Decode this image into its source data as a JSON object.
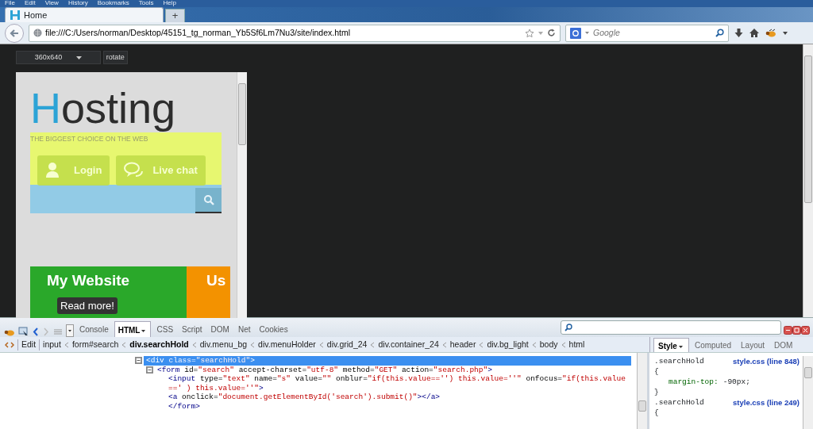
{
  "menu_bar": [
    "File",
    "Edit",
    "View",
    "History",
    "Bookmarks",
    "Tools",
    "Help"
  ],
  "tabs": [
    {
      "label": "Home",
      "selected": true
    }
  ],
  "new_tab": "+",
  "address_bar": {
    "value": "file:///C:/Users/norman/Desktop/45151_tg_norman_Yb5Sf6Lm7Nu3/site/index.html"
  },
  "search_bar": {
    "placeholder": "Google"
  },
  "responsive_toolbar": {
    "device": "360x640",
    "rotate": "rotate"
  },
  "preview": {
    "logo_initial": "H",
    "logo_rest": "osting",
    "tagline": "THE BIGGEST CHOICE ON THE WEB",
    "buttons": [
      {
        "kind": "user",
        "label": "Login"
      },
      {
        "kind": "chat",
        "label": "Live chat"
      }
    ],
    "tiles": [
      {
        "title": "My Website",
        "button": "Read more!",
        "color": "#2aa82a"
      },
      {
        "title": "Us",
        "color": "#f39200"
      }
    ]
  },
  "firebug": {
    "panels": [
      {
        "label": "Console",
        "selected": false
      },
      {
        "label": "HTML",
        "selected": true
      },
      {
        "label": "CSS",
        "selected": false
      },
      {
        "label": "Script",
        "selected": false
      },
      {
        "label": "DOM",
        "selected": false
      },
      {
        "label": "Net",
        "selected": false
      },
      {
        "label": "Cookies",
        "selected": false
      }
    ],
    "edit": "Edit",
    "breadcrumbs": [
      {
        "label": "input",
        "selected": false
      },
      {
        "label": "form#search",
        "selected": false
      },
      {
        "label": "div.searchHold",
        "selected": true
      },
      {
        "label": "div.menu_bg",
        "selected": false
      },
      {
        "label": "div.menuHolder",
        "selected": false
      },
      {
        "label": "div.grid_24",
        "selected": false
      },
      {
        "label": "div.container_24",
        "selected": false
      },
      {
        "label": "header",
        "selected": false
      },
      {
        "label": "div.bg_light",
        "selected": false
      },
      {
        "label": "body",
        "selected": false
      },
      {
        "label": "html",
        "selected": false
      }
    ],
    "side_tabs": [
      {
        "label": "Style",
        "selected": true
      },
      {
        "label": "Computed",
        "selected": false
      },
      {
        "label": "Layout",
        "selected": false
      },
      {
        "label": "DOM",
        "selected": false
      }
    ],
    "html_tree": [
      {
        "expanded": true,
        "selected": true,
        "segments": [
          {
            "kind": "tag",
            "text": "<div"
          },
          {
            "kind": "attr",
            "text": " class="
          },
          {
            "kind": "val",
            "text": "\"searchHold\""
          },
          {
            "kind": "tag",
            "text": ">"
          }
        ],
        "children": [
          {
            "expanded": true,
            "selected": false,
            "segments": [
              {
                "kind": "tag",
                "text": "<form"
              },
              {
                "kind": "attr",
                "text": " id="
              },
              {
                "kind": "val",
                "text": "\"search\""
              },
              {
                "kind": "attr",
                "text": " accept-charset="
              },
              {
                "kind": "val",
                "text": "\"utf-8\""
              },
              {
                "kind": "attr",
                "text": " method="
              },
              {
                "kind": "val",
                "text": "\"GET\""
              },
              {
                "kind": "attr",
                "text": " action="
              },
              {
                "kind": "val",
                "text": "\"search.php\""
              },
              {
                "kind": "tag",
                "text": ">"
              }
            ],
            "close": "</form>",
            "children": [
              {
                "selected": false,
                "segments": [
                  {
                    "kind": "tag",
                    "text": "<input"
                  },
                  {
                    "kind": "attr",
                    "text": " type="
                  },
                  {
                    "kind": "val",
                    "text": "\"text\""
                  },
                  {
                    "kind": "attr",
                    "text": " name="
                  },
                  {
                    "kind": "val",
                    "text": "\"s\""
                  },
                  {
                    "kind": "attr",
                    "text": " value="
                  },
                  {
                    "kind": "val",
                    "text": "\"\""
                  },
                  {
                    "kind": "attr",
                    "text": " onblur="
                  },
                  {
                    "kind": "val",
                    "text": "\"if(this.value=='') this.value=''\""
                  },
                  {
                    "kind": "attr",
                    "text": " onfocus="
                  },
                  {
                    "kind": "val",
                    "text": "\"if(this.value ==' ) this.value=''\""
                  },
                  {
                    "kind": "tag",
                    "text": ">"
                  }
                ]
              },
              {
                "selected": false,
                "segments": [
                  {
                    "kind": "tag",
                    "text": "<a"
                  },
                  {
                    "kind": "attr",
                    "text": " onclick="
                  },
                  {
                    "kind": "val",
                    "text": "\"document.getElementById('search').submit()\""
                  },
                  {
                    "kind": "tag",
                    "text": "></a>"
                  }
                ]
              }
            ]
          }
        ]
      }
    ],
    "style_rules": [
      {
        "selector": ".searchHold",
        "source": "style.css (line 848)",
        "open": "{",
        "declarations": [
          {
            "property": "margin-top:",
            "value": "-90px;"
          }
        ],
        "close": "}"
      },
      {
        "selector": ".searchHold",
        "source": "style.css (line 249)",
        "open": "{"
      }
    ]
  }
}
